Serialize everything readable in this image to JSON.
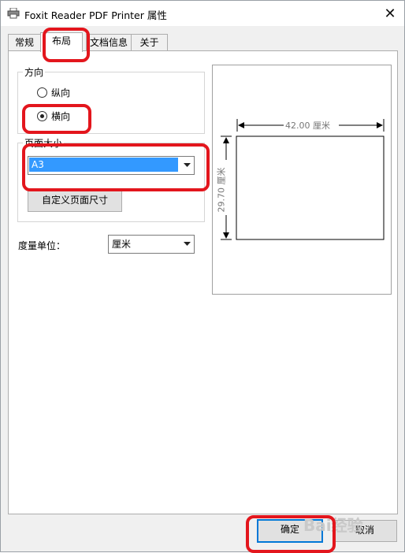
{
  "window": {
    "title": "Foxit Reader PDF Printer 属性",
    "close_icon": "close-icon"
  },
  "tabs": [
    {
      "label": "常规",
      "active": false
    },
    {
      "label": "布局",
      "active": true
    },
    {
      "label": "文档信息",
      "active": false
    },
    {
      "label": "关于",
      "active": false
    }
  ],
  "orientation": {
    "label": "方向",
    "portrait_label": "纵向",
    "landscape_label": "横向",
    "selected": "横向"
  },
  "page_size": {
    "label": "页面大小",
    "selected": "A3",
    "custom_button": "自定义页面尺寸"
  },
  "units": {
    "label": "度量单位：",
    "selected": "厘米"
  },
  "preview": {
    "width_label": "42.00 厘米",
    "height_label": "29.70 厘米"
  },
  "buttons": {
    "ok": "确定",
    "cancel": "取消"
  },
  "watermark": "Bai经验",
  "colors": {
    "highlight": "#e3161d",
    "selection": "#3399ff",
    "focus_border": "#0078d7"
  }
}
